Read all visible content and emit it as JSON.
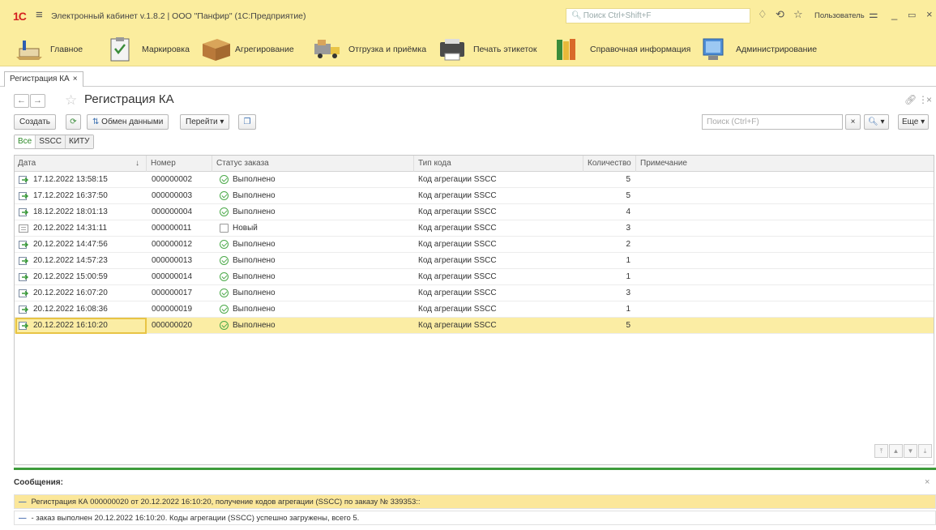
{
  "app": {
    "logo": "1С",
    "title": "Электронный кабинет v.1.8.2 | ООО \"Панфир\" (1С:Предприятие)",
    "search_placeholder": "Поиск Ctrl+Shift+F",
    "user": "Пользователь"
  },
  "sections": [
    {
      "label": "Главное",
      "icon": "home-icon"
    },
    {
      "label": "Маркировка",
      "icon": "clipboard-icon"
    },
    {
      "label": "Агрегирование",
      "icon": "box-icon"
    },
    {
      "label": "Отгрузка и приёмка",
      "icon": "truck-icon"
    },
    {
      "label": "Печать этикеток",
      "icon": "printer-icon"
    },
    {
      "label": "Справочная информация",
      "icon": "books-icon"
    },
    {
      "label": "Администрирование",
      "icon": "computer-icon"
    }
  ],
  "tab": {
    "label": "Регистрация КА",
    "close": "×"
  },
  "form": {
    "title": "Регистрация КА",
    "back": "←",
    "forward": "→"
  },
  "toolbar": {
    "create": "Создать",
    "exchange": "Обмен данными",
    "goto": "Перейти",
    "search_placeholder": "Поиск (Ctrl+F)",
    "clear": "×",
    "more": "Еще"
  },
  "filters": [
    "Все",
    "SSCC",
    "КИТУ"
  ],
  "columns": {
    "date": "Дата",
    "number": "Номер",
    "status": "Статус заказа",
    "code_type": "Тип кода",
    "quantity": "Количество",
    "note": "Примечание"
  },
  "rows": [
    {
      "date": "17.12.2022 13:58:15",
      "number": "000000002",
      "status": "Выполнено",
      "code_type": "Код агрегации SSCC",
      "quantity": "5"
    },
    {
      "date": "17.12.2022 16:37:50",
      "number": "000000003",
      "status": "Выполнено",
      "code_type": "Код агрегации SSCC",
      "quantity": "5"
    },
    {
      "date": "18.12.2022 18:01:13",
      "number": "000000004",
      "status": "Выполнено",
      "code_type": "Код агрегации SSCC",
      "quantity": "4"
    },
    {
      "date": "20.12.2022 14:31:11",
      "number": "000000011",
      "status": "Новый",
      "code_type": "Код агрегации SSCC",
      "quantity": "3"
    },
    {
      "date": "20.12.2022 14:47:56",
      "number": "000000012",
      "status": "Выполнено",
      "code_type": "Код агрегации SSCC",
      "quantity": "2"
    },
    {
      "date": "20.12.2022 14:57:23",
      "number": "000000013",
      "status": "Выполнено",
      "code_type": "Код агрегации SSCC",
      "quantity": "1"
    },
    {
      "date": "20.12.2022 15:00:59",
      "number": "000000014",
      "status": "Выполнено",
      "code_type": "Код агрегации SSCC",
      "quantity": "1"
    },
    {
      "date": "20.12.2022 16:07:20",
      "number": "000000017",
      "status": "Выполнено",
      "code_type": "Код агрегации SSCC",
      "quantity": "3"
    },
    {
      "date": "20.12.2022 16:08:36",
      "number": "000000019",
      "status": "Выполнено",
      "code_type": "Код агрегации SSCC",
      "quantity": "1"
    },
    {
      "date": "20.12.2022 16:10:20",
      "number": "000000020",
      "status": "Выполнено",
      "code_type": "Код агрегации SSCC",
      "quantity": "5"
    }
  ],
  "messages": {
    "title": "Сообщения:",
    "close": "×",
    "items": [
      "Регистрация КА 000000020 от 20.12.2022 16:10:20, получение кодов агрегации (SSCC) по заказу № 339353::",
      "- заказ выполнен 20.12.2022 16:10:20. Коды агрегации (SSCC) успешно загружены, всего 5."
    ]
  },
  "colors": {
    "panel": "#fbed9e",
    "selected_row": "#fbeda4",
    "accent_green": "#3d9b3a",
    "logo_red": "#d4211f"
  }
}
